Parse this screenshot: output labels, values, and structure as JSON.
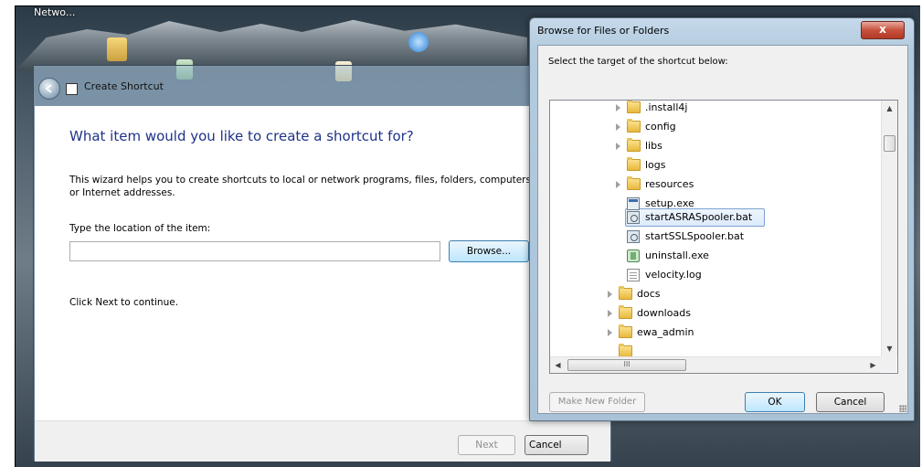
{
  "desktop": {
    "label": "Netwo..."
  },
  "wizard": {
    "title": "Create Shortcut",
    "heading": "What item would you like to create a shortcut for?",
    "description": "This wizard helps you to create shortcuts to local or network programs, files, folders, computers, or Internet addresses.",
    "location_label": "Type the location of the item:",
    "location_value": "",
    "browse_label": "Browse...",
    "continue_text": "Click Next to continue.",
    "next_label": "Next",
    "cancel_label": "Cancel"
  },
  "dialog": {
    "title": "Browse for Files or Folders",
    "close_glyph": "x",
    "instruction": "Select the target of the shortcut below:",
    "tree": [
      {
        "label": ".install4j",
        "type": "folder",
        "expandable": true,
        "level": 2
      },
      {
        "label": "config",
        "type": "folder",
        "expandable": true,
        "level": 2
      },
      {
        "label": "libs",
        "type": "folder",
        "expandable": true,
        "level": 2
      },
      {
        "label": "logs",
        "type": "folder",
        "expandable": false,
        "level": 2
      },
      {
        "label": "resources",
        "type": "folder",
        "expandable": true,
        "level": 2
      },
      {
        "label": "setup.exe",
        "type": "exe",
        "expandable": false,
        "level": 2
      },
      {
        "label": "startASRASpooler.bat",
        "type": "bat",
        "expandable": false,
        "level": 2,
        "selected": true
      },
      {
        "label": "startSSLSpooler.bat",
        "type": "bat",
        "expandable": false,
        "level": 2
      },
      {
        "label": "uninstall.exe",
        "type": "uninstall",
        "expandable": false,
        "level": 2
      },
      {
        "label": "velocity.log",
        "type": "log",
        "expandable": false,
        "level": 2
      },
      {
        "label": "docs",
        "type": "folder",
        "expandable": true,
        "level": 1
      },
      {
        "label": "downloads",
        "type": "folder",
        "expandable": true,
        "level": 1
      },
      {
        "label": "ewa_admin",
        "type": "folder",
        "expandable": true,
        "level": 1
      }
    ],
    "hscroll_glyph": "III",
    "make_folder_label": "Make New Folder",
    "ok_label": "OK",
    "cancel_label": "Cancel"
  }
}
